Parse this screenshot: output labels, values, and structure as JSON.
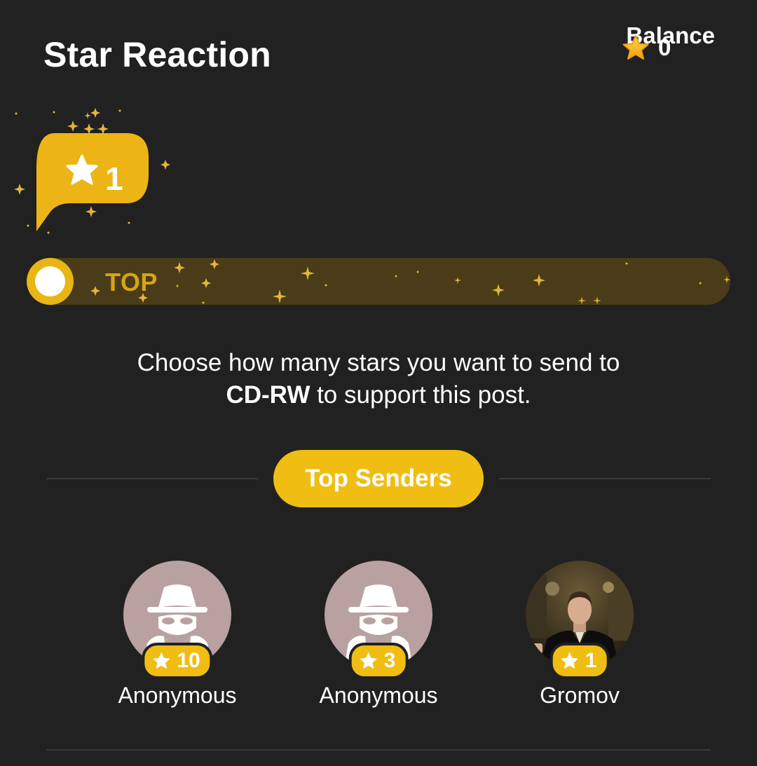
{
  "header": {
    "title": "Star Reaction",
    "balance_label": "Balance",
    "balance_value": "0"
  },
  "bubble": {
    "value": "1"
  },
  "slider": {
    "label": "TOP",
    "level": 0
  },
  "description": {
    "line1": "Choose how many stars you want to send to",
    "channel": "CD-RW",
    "line2_rest": " to support this post."
  },
  "top_senders": {
    "button_label": "Top Senders",
    "senders": [
      {
        "name": "Anonymous",
        "stars": "10",
        "avatar": "anonymous-icon"
      },
      {
        "name": "Anonymous",
        "stars": "3",
        "avatar": "anonymous-icon"
      },
      {
        "name": "Gromov",
        "stars": "1",
        "avatar": "user-photo"
      }
    ]
  },
  "colors": {
    "background": "#212121",
    "accent": "#f0bd12",
    "track": "#4a3c18",
    "anon_avatar": "#b9a1a2"
  }
}
